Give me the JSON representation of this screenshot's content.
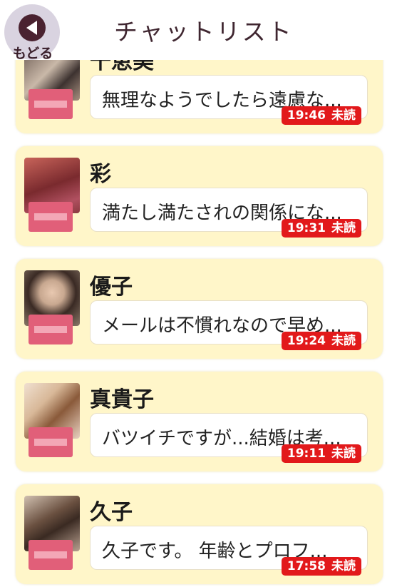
{
  "header": {
    "title": "チャットリスト",
    "back_label": "もどる"
  },
  "chats": [
    {
      "name": "千恵美",
      "message": "無理なようでしたら遠慮な...",
      "time": "19:46",
      "status": "未読"
    },
    {
      "name": "彩",
      "message": "満たし満たされの関係にな...",
      "time": "19:31",
      "status": "未読"
    },
    {
      "name": "優子",
      "message": "メールは不慣れなので早め...",
      "time": "19:24",
      "status": "未読"
    },
    {
      "name": "真貴子",
      "message": "バツイチですが...結婚は考...",
      "time": "19:11",
      "status": "未読"
    },
    {
      "name": "久子",
      "message": "久子です。 年齢とプロフ...",
      "time": "17:58",
      "status": "未読"
    }
  ],
  "colors": {
    "card_bg": "#fff6c9",
    "unread_badge": "#e2191b",
    "title_text": "#3f2630",
    "back_button_bg": "#d9d3e0",
    "back_button_icon": "#4a2230"
  }
}
